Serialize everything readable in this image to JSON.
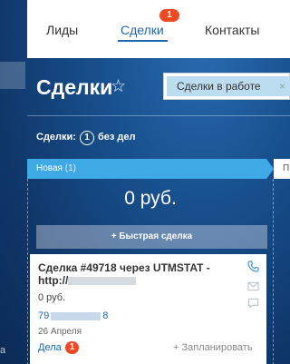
{
  "nav": {
    "tabs": [
      {
        "label": "Лиды"
      },
      {
        "label": "Сделки",
        "badge": "1"
      },
      {
        "label": "Контакты"
      }
    ],
    "rail_letter": "а"
  },
  "header": {
    "title": "Сделки",
    "filter_chip": "Сделки в работе",
    "filter_chip_close": "×"
  },
  "counter": {
    "label": "Сделки:",
    "value": "1",
    "text": "без дел"
  },
  "stage": {
    "name": "Новая",
    "count": "(1)",
    "next_label": "П",
    "total": "0 руб.",
    "quick_deal_label": "+ Быстрая сделка"
  },
  "card": {
    "title_prefix": "Сделка #49718 через UTMSTAT - http://",
    "amount": "0 руб.",
    "phone_start": "79",
    "phone_end": "8",
    "date": "26 Апреля",
    "tasks_label": "Дела",
    "tasks_badge": "1",
    "plan_label": "+ Запланировать"
  },
  "colors": {
    "accent": "#2067b0",
    "stage": "#3fa9e6",
    "badge": "#f04a24"
  }
}
